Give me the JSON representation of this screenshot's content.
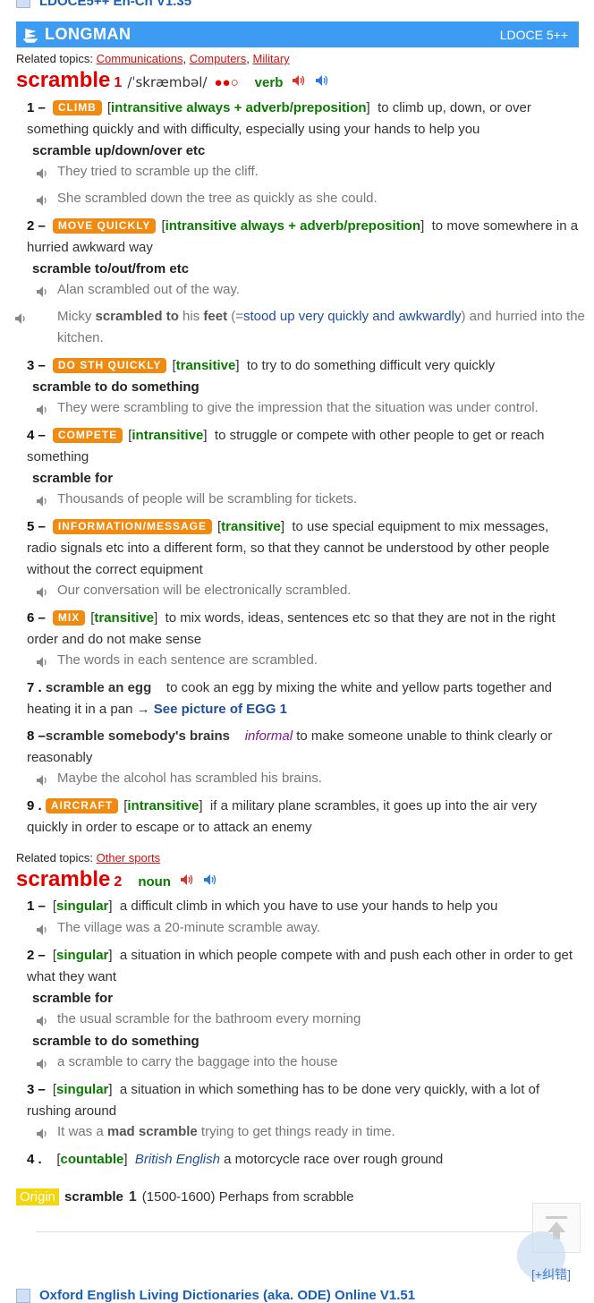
{
  "top_dict": "LDOCE5++ En-Cn V1.35",
  "bar": {
    "logo": "LONGMAN",
    "version": "LDOCE 5++"
  },
  "entry1": {
    "related_label": "Related topics:",
    "related": [
      "Communications",
      "Computers",
      "Military"
    ],
    "word": "scramble",
    "hom": "1",
    "pron": "/ˈskræmbəl/",
    "freq": "●●○",
    "pos": "verb",
    "senses": [
      {
        "n": "1",
        "signpost": "CLIMB",
        "gram": "intransitive always + adverb/preposition",
        "def": "to climb up, down, or over something quickly and with difficulty, especially using your hands to help you",
        "patterns": [
          {
            "p": "scramble up/down/over etc",
            "ex": [
              "They tried to scramble up the cliff.",
              "She scrambled down the tree as quickly as she could."
            ]
          }
        ]
      },
      {
        "n": "2",
        "signpost": "MOVE QUICKLY",
        "gram": "intransitive always + adverb/preposition",
        "def": "to move somewhere in a hurried awkward way",
        "patterns": [
          {
            "p": "scramble to/out/from etc",
            "ex": [
              "Alan scrambled out of the way."
            ]
          }
        ],
        "ex_special": {
          "a": "Micky ",
          "b1": "scrambled to",
          "c": " his ",
          "b2": "feet",
          "d": " (=",
          "gloss": "stood up very quickly and awkwardly",
          "e": ") and hurried into the kitchen."
        }
      },
      {
        "n": "3",
        "signpost": "DO STH QUICKLY",
        "gram": "transitive",
        "def": "to try to do something difficult very quickly",
        "patterns": [
          {
            "p": "scramble to do something",
            "ex": [
              "They were scrambling to give the impression that the situation was under control."
            ]
          }
        ]
      },
      {
        "n": "4",
        "signpost": "COMPETE",
        "gram": "intransitive",
        "def": "to struggle or compete with other people to get or reach something",
        "patterns": [
          {
            "p": "scramble for",
            "ex": [
              "Thousands of people will be scrambling for tickets."
            ]
          }
        ]
      },
      {
        "n": "5",
        "signpost": "INFORMATION/MESSAGE",
        "gram": "transitive",
        "def": "to use special equipment to mix messages, radio signals etc into a different form, so that they cannot be understood by other people without the correct equipment",
        "ex": [
          "Our conversation will be electronically scrambled."
        ]
      },
      {
        "n": "6",
        "signpost": "MIX",
        "gram": "transitive",
        "def": "to mix words, ideas, sentences etc so that they are not in the right order and do not make sense",
        "ex": [
          "The words in each sentence are scrambled."
        ]
      },
      {
        "n": "7",
        "phrase": "scramble an egg",
        "def": "to cook an egg by mixing the white and yellow parts together and heating it in a pan",
        "arrow": "→",
        "see": "See picture of EGG 1"
      },
      {
        "n": "8",
        "phrase": "scramble somebody's brains",
        "register": "informal",
        "def": "to make someone unable to think clearly or reasonably",
        "ex": [
          "Maybe the alcohol has scrambled his brains."
        ]
      },
      {
        "n": "9",
        "signpost": "AIRCRAFT",
        "gram": "intransitive",
        "def": "if a military plane scrambles, it goes up into the air very quickly in order to escape or to attack an enemy"
      }
    ]
  },
  "entry2": {
    "related_label": "Related topics:",
    "related": [
      "Other sports"
    ],
    "word": "scramble",
    "hom": "2",
    "pos": "noun",
    "senses": [
      {
        "n": "1",
        "gram": "singular",
        "def": "a difficult climb in which you have to use your hands to help you",
        "ex": [
          "The village was a 20-minute scramble away."
        ]
      },
      {
        "n": "2",
        "gram": "singular",
        "def": "a situation in which people compete with and push each other in order to get what they want",
        "patterns": [
          {
            "p": "scramble for",
            "ex": [
              "the usual scramble for the bathroom every morning"
            ]
          },
          {
            "p": "scramble to do something",
            "ex": [
              "a scramble to carry the baggage into the house"
            ]
          }
        ]
      },
      {
        "n": "3",
        "gram": "singular",
        "def": "a situation in which something has to be done very quickly, with a lot of rushing around",
        "ex_special": {
          "a": "It was a ",
          "b": "mad scramble",
          "c": " trying to get things ready in time."
        }
      },
      {
        "n": "4",
        "gram": "countable",
        "register": "British English",
        "def": "a motorcycle race over rough ground"
      }
    ]
  },
  "origin": {
    "tag": "Origin",
    "word": "scramble",
    "hom": "1",
    "text": "(1500-1600) Perhaps from scrabble"
  },
  "report_link": "[+纠错]",
  "bottom_dict": "Oxford English Living Dictionaries (aka. ODE) Online V1.51",
  "colors": {
    "accent": "#3d9cf2",
    "headword": "#e00000",
    "signpost": "#f08a10",
    "grammar": "#0a7a00"
  }
}
